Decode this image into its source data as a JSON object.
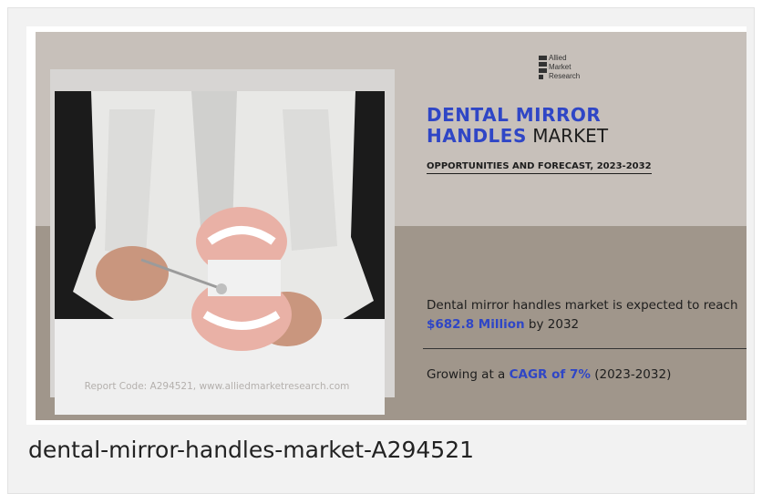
{
  "infographic": {
    "report_code": "Report Code: A294521, www.alliedmarketresearch.com",
    "logo_lines": [
      "Allied",
      "Market",
      "Research"
    ],
    "title_highlight_1": "DENTAL MIRROR",
    "title_highlight_2": "HANDLES",
    "title_plain": " MARKET",
    "subtitle": "OPPORTUNITIES AND FORECAST, 2023-2032",
    "stat1_prefix": "Dental mirror handles market is expected to reach ",
    "stat1_value": "$682.8 Million",
    "stat1_suffix": " by 2032",
    "stat2_prefix": "Growing at a ",
    "stat2_value": "CAGR of 7%",
    "stat2_suffix": " (2023-2032)"
  },
  "caption": "dental-mirror-handles-market-A294521",
  "colors": {
    "accent": "#2f46c6",
    "top_band": "#c7c0ba",
    "bottom_band": "#a0968b"
  }
}
